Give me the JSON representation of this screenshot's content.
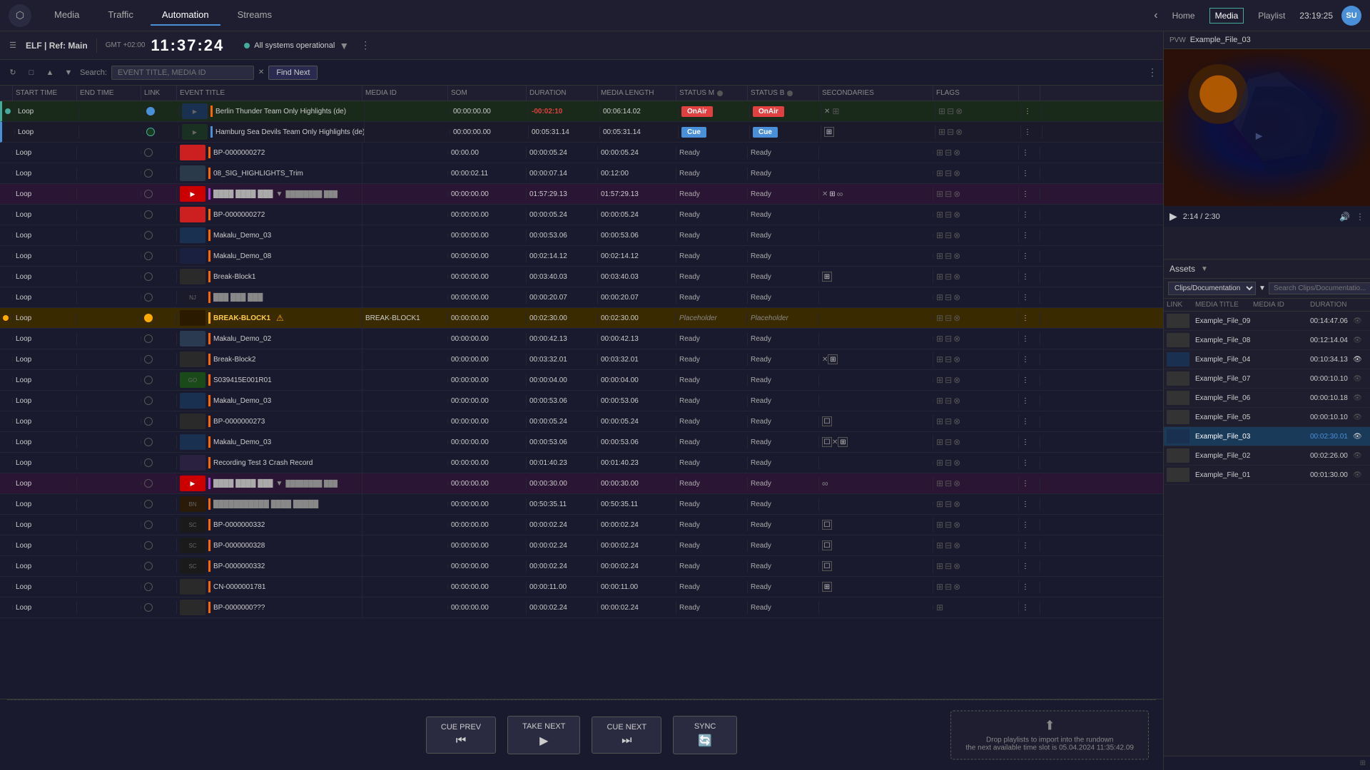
{
  "nav": {
    "tabs": [
      {
        "label": "Media",
        "active": false
      },
      {
        "label": "Traffic",
        "active": false
      },
      {
        "label": "Automation",
        "active": true
      },
      {
        "label": "Streams",
        "active": false
      }
    ],
    "right": {
      "home": "Home",
      "media": "Media",
      "playlist": "Playlist",
      "time": "23:19:25",
      "user": "SU"
    }
  },
  "toolbar": {
    "ref_label": "ELF | Ref: Main",
    "gmt": "GMT +02:00",
    "clock": "11:37:24",
    "status": "All systems operational"
  },
  "search": {
    "label": "Search:",
    "placeholder": "EVENT TITLE, MEDIA ID",
    "find_next": "Find Next"
  },
  "table": {
    "headers": [
      "",
      "START TIME",
      "END TIME",
      "LINK",
      "EVENT TITLE",
      "MEDIA ID",
      "SOM",
      "DURATION",
      "MEDIA LENGTH",
      "STATUS M",
      "STATUS B",
      "SECONDARIES",
      "FLAGS",
      ""
    ],
    "rows": [
      {
        "type": "on-air",
        "start": "",
        "end": "",
        "link": "",
        "title": "Berlin Thunder Team Only Highlights (de)",
        "media_id": "",
        "som": "00:00:00.00",
        "duration": "-00:02:10",
        "media_length": "00:06:14.02",
        "status_m": "OnAir",
        "status_b": "OnAir",
        "secondaries": "",
        "thumb_color": "blue"
      },
      {
        "type": "cue",
        "start": "",
        "end": "",
        "link": "",
        "title": "Hamburg Sea Devils Team Only Highlights (de)",
        "media_id": "",
        "som": "00:00:00.00",
        "duration": "00:05:31.14",
        "media_length": "00:05:31.14",
        "status_m": "Cue",
        "status_b": "Cue",
        "secondaries": "",
        "thumb_color": "green"
      },
      {
        "type": "normal",
        "start": "",
        "end": "",
        "link": "",
        "title": "BP-0000000272",
        "media_id": "",
        "som": "00:00.00",
        "duration": "00:00:05.24",
        "media_length": "00:00:05.24",
        "status_m": "Ready",
        "status_b": "Ready",
        "secondaries": "",
        "thumb_color": "red"
      },
      {
        "type": "normal",
        "start": "",
        "end": "",
        "link": "",
        "title": "08_SIG_HIGHLIGHTS_Trim",
        "media_id": "",
        "som": "00:00:02.11",
        "duration": "00:00:07.14",
        "media_length": "00:12:00",
        "status_m": "Ready",
        "status_b": "Ready",
        "secondaries": "",
        "thumb_color": "gray"
      },
      {
        "type": "purple",
        "start": "",
        "end": "",
        "link": "",
        "title": "",
        "media_id": "",
        "som": "00:00:00.00",
        "duration": "01:57:29.13",
        "media_length": "01:57:29.13",
        "status_m": "Ready",
        "status_b": "Ready",
        "secondaries": "",
        "thumb_color": "red-logo"
      },
      {
        "type": "normal",
        "start": "",
        "end": "",
        "link": "",
        "title": "BP-0000000272",
        "media_id": "",
        "som": "00:00:00.00",
        "duration": "00:00:05.24",
        "media_length": "00:00:05.24",
        "status_m": "Ready",
        "status_b": "Ready",
        "secondaries": "",
        "thumb_color": "red"
      },
      {
        "type": "normal",
        "start": "",
        "end": "",
        "link": "",
        "title": "Makalu_Demo_03",
        "media_id": "",
        "som": "00:00:00.00",
        "duration": "00:00:53.06",
        "media_length": "00:00:53.06",
        "status_m": "Ready",
        "status_b": "Ready",
        "secondaries": "",
        "thumb_color": "blue"
      },
      {
        "type": "normal",
        "start": "",
        "end": "",
        "link": "",
        "title": "Makalu_Demo_08",
        "media_id": "",
        "som": "00:00:00.00",
        "duration": "00:02:14.12",
        "media_length": "00:02:14.12",
        "status_m": "Ready",
        "status_b": "Ready",
        "secondaries": "",
        "thumb_color": "blue2"
      },
      {
        "type": "normal",
        "start": "",
        "end": "",
        "link": "",
        "title": "Break-Block1",
        "media_id": "",
        "som": "00:00:00.00",
        "duration": "00:03:40.03",
        "media_length": "00:03:40.03",
        "status_m": "Ready",
        "status_b": "Ready",
        "secondaries": "",
        "thumb_color": "gray"
      },
      {
        "type": "normal",
        "start": "",
        "end": "",
        "link": "",
        "title": "",
        "media_id": "",
        "som": "00:00:00.00",
        "duration": "00:00:20.07",
        "media_length": "00:00:20.07",
        "status_m": "Ready",
        "status_b": "Ready",
        "secondaries": "",
        "thumb_color": "logo"
      },
      {
        "type": "break",
        "start": "",
        "end": "",
        "link": "",
        "title": "BREAK-BLOCK1",
        "media_id": "BREAK-BLOCK1",
        "som": "00:00:00.00",
        "duration": "00:02:30.00",
        "media_length": "00:02:30.00",
        "status_m": "Placeholder",
        "status_b": "Placeholder",
        "secondaries": "",
        "thumb_color": "dark"
      },
      {
        "type": "normal",
        "start": "",
        "end": "",
        "link": "",
        "title": "Makalu_Demo_02",
        "media_id": "",
        "som": "00:00:00.00",
        "duration": "00:00:42.13",
        "media_length": "00:00:42.13",
        "status_m": "Ready",
        "status_b": "Ready",
        "secondaries": "",
        "thumb_color": "blue3"
      },
      {
        "type": "normal",
        "start": "",
        "end": "",
        "link": "",
        "title": "Break-Block2",
        "media_id": "",
        "som": "00:00:00.00",
        "duration": "00:03:32.01",
        "media_length": "00:03:32.01",
        "status_m": "Ready",
        "status_b": "Ready",
        "secondaries": "",
        "thumb_color": "gray"
      },
      {
        "type": "normal",
        "start": "",
        "end": "",
        "link": "",
        "title": "S039415E001R01",
        "media_id": "",
        "som": "00:00:00.00",
        "duration": "00:00:04.00",
        "media_length": "00:00:04.00",
        "status_m": "Ready",
        "status_b": "Ready",
        "secondaries": "",
        "thumb_color": "green2"
      },
      {
        "type": "normal",
        "start": "",
        "end": "",
        "link": "",
        "title": "Makalu_Demo_03",
        "media_id": "",
        "som": "00:00:00.00",
        "duration": "00:00:53.06",
        "media_length": "00:00:53.06",
        "status_m": "Ready",
        "status_b": "Ready",
        "secondaries": "",
        "thumb_color": "blue"
      },
      {
        "type": "normal",
        "start": "",
        "end": "",
        "link": "",
        "title": "BP-0000000273",
        "media_id": "",
        "som": "00:00:00.00",
        "duration": "00:00:05.24",
        "media_length": "00:00:05.24",
        "status_m": "Ready",
        "status_b": "Ready",
        "secondaries": "",
        "thumb_color": "gray2"
      },
      {
        "type": "normal",
        "start": "",
        "end": "",
        "link": "",
        "title": "Makalu_Demo_03",
        "media_id": "",
        "som": "00:00:00.00",
        "duration": "00:00:53.06",
        "media_length": "00:00:53.06",
        "status_m": "Ready",
        "status_b": "Ready",
        "secondaries": "",
        "thumb_color": "blue"
      },
      {
        "type": "normal",
        "start": "",
        "end": "",
        "link": "",
        "title": "Recording Test 3 Crash Record",
        "media_id": "",
        "som": "00:00:00.00",
        "duration": "00:01:40.23",
        "media_length": "00:01:40.23",
        "status_m": "Ready",
        "status_b": "Ready",
        "secondaries": "",
        "thumb_color": "gray"
      },
      {
        "type": "purple",
        "start": "",
        "end": "",
        "link": "",
        "title": "",
        "media_id": "",
        "som": "00:00:00.00",
        "duration": "00:00:30.00",
        "media_length": "00:00:30.00",
        "status_m": "Ready",
        "status_b": "Ready",
        "secondaries": "",
        "thumb_color": "red-logo"
      },
      {
        "type": "normal",
        "start": "",
        "end": "",
        "link": "",
        "title": "",
        "media_id": "",
        "som": "00:00:00.00",
        "duration": "00:50:35.11",
        "media_length": "00:50:35.11",
        "status_m": "Ready",
        "status_b": "Ready",
        "secondaries": "",
        "thumb_color": "banner"
      },
      {
        "type": "normal",
        "start": "",
        "end": "",
        "link": "",
        "title": "BP-0000000332",
        "media_id": "",
        "som": "00:00:00.00",
        "duration": "00:00:02.24",
        "media_length": "00:00:02.24",
        "status_m": "Ready",
        "status_b": "Ready",
        "secondaries": "",
        "thumb_color": "logo2"
      },
      {
        "type": "normal",
        "start": "",
        "end": "",
        "link": "",
        "title": "BP-0000000328",
        "media_id": "",
        "som": "00:00:00.00",
        "duration": "00:00:02.24",
        "media_length": "00:00:02.24",
        "status_m": "Ready",
        "status_b": "Ready",
        "secondaries": "",
        "thumb_color": "logo3"
      },
      {
        "type": "normal",
        "start": "",
        "end": "",
        "link": "",
        "title": "BP-0000000332",
        "media_id": "",
        "som": "00:00:00.00",
        "duration": "00:00:02.24",
        "media_length": "00:00:02.24",
        "status_m": "Ready",
        "status_b": "Ready",
        "secondaries": "",
        "thumb_color": "logo2"
      },
      {
        "type": "normal",
        "start": "",
        "end": "",
        "link": "",
        "title": "CN-0000001781",
        "media_id": "",
        "som": "00:00:00.00",
        "duration": "00:00:11.00",
        "media_length": "00:00:11.00",
        "status_m": "Ready",
        "status_b": "Ready",
        "secondaries": "",
        "thumb_color": "gray"
      },
      {
        "type": "normal",
        "start": "",
        "end": "",
        "link": "",
        "title": "BP-0000000???",
        "media_id": "",
        "som": "00:00:00.00",
        "duration": "00:00:02.24",
        "media_length": "00:00:02.24",
        "status_m": "Ready",
        "status_b": "Ready",
        "secondaries": "",
        "thumb_color": "gray"
      }
    ]
  },
  "transport": {
    "cue_prev": "CUE PREV",
    "take_next": "TAKE NEXT",
    "cue_next": "CUE NEXT",
    "sync": "SYNC",
    "drop_text": "Drop playlists to import into the rundown",
    "next_slot": "the next available time slot is 05.04.2024 11:35:42.09"
  },
  "right_panel": {
    "pvw_label": "PVW",
    "pvw_title": "Example_File_03",
    "video_time": "2:14 / 2:30",
    "assets_title": "Assets",
    "folder": "Clips/Documentation",
    "search_placeholder": "Search Clips/Documentatio...",
    "table_headers": [
      "LINK",
      "MEDIA TITLE",
      "MEDIA ID",
      "DURATION",
      ""
    ],
    "assets": [
      {
        "name": "Example_File_09",
        "id": "",
        "duration": "00:14:47.06",
        "selected": false,
        "has_thumb": false
      },
      {
        "name": "Example_File_08",
        "id": "",
        "duration": "00:12:14.04",
        "selected": false,
        "has_thumb": false
      },
      {
        "name": "Example_File_04",
        "id": "",
        "duration": "00:10:34.13",
        "selected": false,
        "has_thumb": true
      },
      {
        "name": "Example_File_07",
        "id": "",
        "duration": "00:00:10.10",
        "selected": false,
        "has_thumb": false
      },
      {
        "name": "Example_File_06",
        "id": "",
        "duration": "00:00:10.18",
        "selected": false,
        "has_thumb": false
      },
      {
        "name": "Example_File_05",
        "id": "",
        "duration": "00:00:10.10",
        "selected": false,
        "has_thumb": false
      },
      {
        "name": "Example_File_03",
        "id": "",
        "duration": "00:02:30.01",
        "selected": true,
        "has_thumb": false
      },
      {
        "name": "Example_File_02",
        "id": "",
        "duration": "00:02:26.00",
        "selected": false,
        "has_thumb": false
      },
      {
        "name": "Example_File_01",
        "id": "",
        "duration": "00:01:30.00",
        "selected": false,
        "has_thumb": false
      }
    ]
  }
}
